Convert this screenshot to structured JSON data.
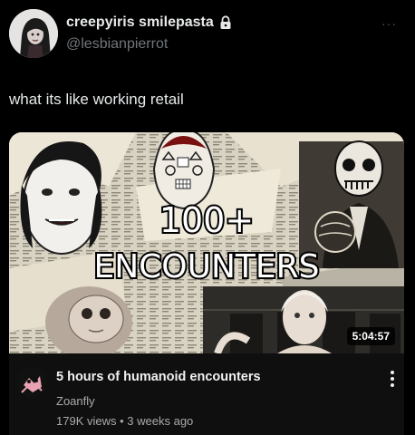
{
  "post": {
    "display_name": "creepyiris smilepasta",
    "handle": "@lesbianpierrot",
    "text": "what its like working retail",
    "more_label": "···"
  },
  "video": {
    "thumbnail_title_line1": "100+",
    "thumbnail_title_line2": "ENCOUNTERS",
    "duration": "5:04:57",
    "title": "5 hours of humanoid encounters",
    "channel": "Zoanfly",
    "views": "179K views",
    "separator": "•",
    "age": "3 weeks ago"
  },
  "icons": {
    "lock": "lock-icon",
    "more": "more-horizontal-icon",
    "video_menu": "more-vertical-icon"
  },
  "colors": {
    "background": "#000000",
    "primary_text": "#e7e9ea",
    "secondary_text": "#71767b",
    "card_background": "#0f0f0f"
  }
}
